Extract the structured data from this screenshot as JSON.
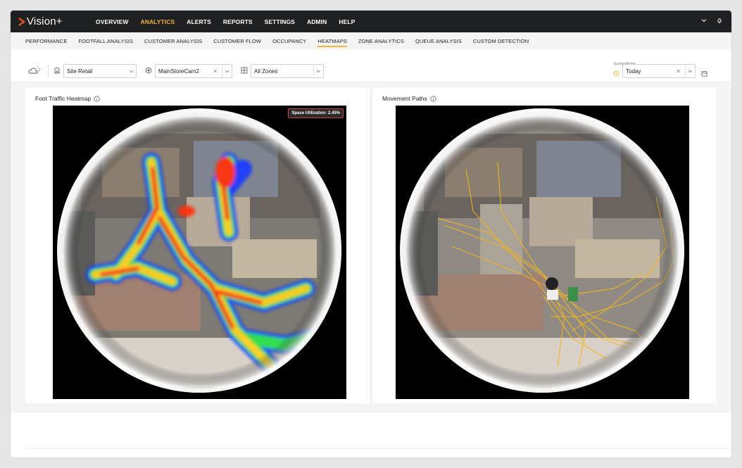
{
  "brand": {
    "name": "Vision+",
    "accent": "#f5b335",
    "logo_chevron_color": "#e8541e"
  },
  "main_nav": [
    {
      "label": "OVERVIEW",
      "active": false
    },
    {
      "label": "ANALYTICS",
      "active": true
    },
    {
      "label": "ALERTS",
      "active": false
    },
    {
      "label": "REPORTS",
      "active": false
    },
    {
      "label": "SETTINGS",
      "active": false
    },
    {
      "label": "ADMIN",
      "active": false
    },
    {
      "label": "HELP",
      "active": false
    }
  ],
  "topbar_icons": [
    "chevron-down-icon",
    "bell-icon"
  ],
  "sub_nav": [
    {
      "label": "PERFORMANCE",
      "active": false
    },
    {
      "label": "FOOTFALL ANALYSIS",
      "active": false
    },
    {
      "label": "CUSTOMER ANALYSIS",
      "active": false
    },
    {
      "label": "CUSTOMER FLOW",
      "active": false
    },
    {
      "label": "OCCUPANCY",
      "active": false
    },
    {
      "label": "HEATMAPS",
      "active": true
    },
    {
      "label": "ZONE ANALYTICS",
      "active": false
    },
    {
      "label": "QUEUE ANALYSIS",
      "active": false
    },
    {
      "label": "CUSTOM DETECTION",
      "active": false
    }
  ],
  "filters": {
    "site": {
      "icon": "building-icon",
      "value": "Site Retail"
    },
    "camera": {
      "icon": "camera-icon",
      "value": "MainStoreCam2"
    },
    "zones": {
      "icon": "zones-icon",
      "value": "All Zones"
    },
    "timezone": "Europe/Rome",
    "date": {
      "icon": "clock-icon",
      "value": "Today"
    }
  },
  "panels": {
    "heatmap": {
      "title": "Foot Traffic Heatmap",
      "badge": "Space Utilization: 2.45%"
    },
    "paths": {
      "title": "Movement Paths"
    }
  }
}
